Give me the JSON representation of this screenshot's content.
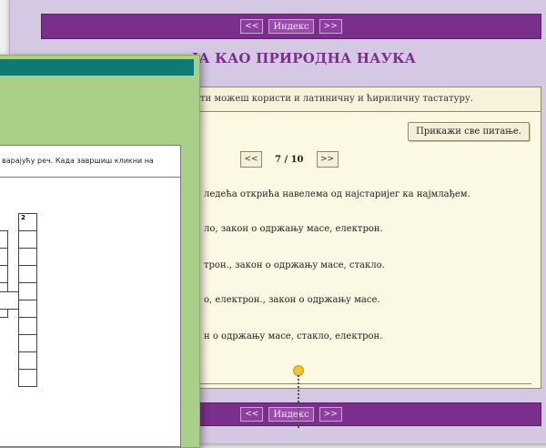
{
  "nav": {
    "prev_label": "<<",
    "next_label": ">>",
    "index_label": "Индекс"
  },
  "title": "ЈА КАО ПРИРОДНА НАУКА",
  "hint": "ти можеш користи и латиничну и ћириличну тастатуру.",
  "show_all_label": "Прикажи све питање.",
  "pager": {
    "prev": "<<",
    "count": "7 / 10",
    "next": ">>"
  },
  "question": "ледећа открића навелема од најстаријег ка најмлађем.",
  "answers": [
    "ло, закон о одржању масе, електрон.",
    "трон., закон о одржању масе, стакло.",
    "о, електрон., закон о одржању масе.",
    "н о одржању масе, стакло, електрон."
  ],
  "crossword": {
    "instruction": "варајућу реч. Када завршиш кликни на",
    "clue_number": "2"
  },
  "colors": {
    "purple": "#7b2f8c",
    "lavender": "#d4c8e3",
    "cream": "#fbf8e4",
    "green": "#a9cf88",
    "teal": "#0f7a72",
    "pointer": "#f2c230"
  }
}
